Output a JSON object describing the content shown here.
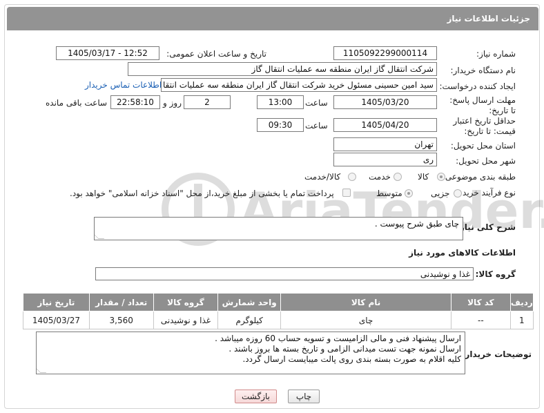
{
  "header": {
    "title": "جزئیات اطلاعات نیاز"
  },
  "fields": {
    "need_number": {
      "label": "شماره نیاز:",
      "value": "1105092299000114"
    },
    "announce": {
      "label": "تاریخ و ساعت اعلان عمومی:",
      "value": "1405/03/17 - 12:52"
    },
    "buyer_org": {
      "label": "نام دستگاه خریدار:",
      "value": "شرکت انتقال گاز ایران منطقه سه عملیات انتقال گاز"
    },
    "requester": {
      "label": "ایجاد کننده درخواست:",
      "value": "سید امین حسینی مسئول خرید شرکت انتقال گاز ایران منطقه سه عملیات انتقا",
      "contact_link": "اطلاعات تماس خریدار"
    },
    "reply_deadline": {
      "label": "مهلت ارسال پاسخ: تا تاریخ:",
      "date": "1405/03/20",
      "time_label": "ساعت",
      "time": "13:00",
      "days": "2",
      "days_label": "روز و",
      "remaining": "22:58:10",
      "remaining_label": "ساعت باقی مانده"
    },
    "price_deadline": {
      "label": "حداقل تاریخ اعتبار قیمت: تا تاریخ:",
      "date": "1405/04/20",
      "time_label": "ساعت",
      "time": "09:30"
    },
    "province": {
      "label": "استان محل تحویل:",
      "value": "تهران"
    },
    "city": {
      "label": "شهر محل تحویل:",
      "value": "ری"
    },
    "category": {
      "label": "طبقه بندی موضوعی:",
      "options": [
        "کالا",
        "خدمت",
        "کالا/خدمت"
      ],
      "selected": "کالا"
    },
    "process": {
      "label": "نوع فرآیند خرید :",
      "options": [
        "جزیی",
        "متوسط"
      ],
      "selected": "متوسط",
      "payment_note": "پرداخت تمام یا بخشی از مبلغ خرید،از محل \"اسناد خزانه اسلامی\" خواهد بود."
    },
    "description": {
      "label": "شرح کلی نیاز:",
      "value": "چای طبق شرح پیوست ."
    }
  },
  "goods": {
    "section_title": "اطلاعات کالاهای مورد نیاز",
    "group_label": "گروه کالا:",
    "group_value": "غذا و نوشیدنی",
    "columns": [
      "ردیف",
      "کد کالا",
      "نام کالا",
      "واحد شمارش",
      "گروه کالا",
      "تعداد / مقدار",
      "تاریخ نیاز"
    ],
    "rows": [
      [
        "1",
        "--",
        "چای",
        "کیلوگرم",
        "غذا و نوشیدنی",
        "3,560",
        "1405/03/27"
      ]
    ]
  },
  "buyer_notes": {
    "label": "توضیحات خریدار:",
    "lines": [
      "ارسال پیشنهاد فنی و مالی الزامیست و تسویه حساب 60 روزه میباشد .",
      "ارسال نمونه جهت تست میدانی الزامی و تاریخ بسته ها بروز باشند .",
      "کلیه اقلام به صورت بسته بندی روی پالت میبایست ارسال گردد."
    ]
  },
  "buttons": {
    "print": "چاپ",
    "back": "بازگشت"
  },
  "watermark": {
    "text": "AriaTender.net"
  },
  "colors": {
    "header_bg": "#939393",
    "table_header_bg": "#8f8f8f",
    "link": "#1a5fb4",
    "back_button": "#f5d8d8"
  }
}
